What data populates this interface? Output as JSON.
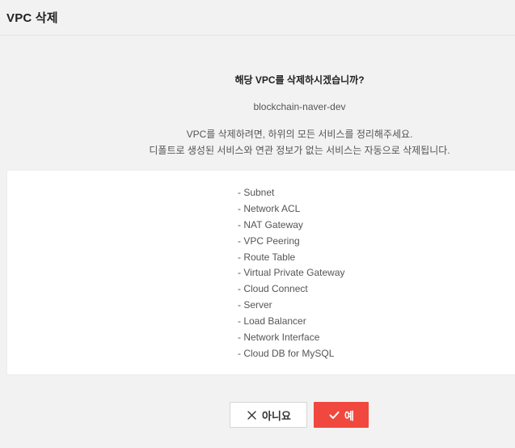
{
  "dialog": {
    "title": "VPC 삭제",
    "question": "해당 VPC를 삭제하시겠습니까?",
    "vpc_name": "blockchain-naver-dev",
    "description_line1": "VPC를 삭제하려면, 하위의 모든 서비스를 정리해주세요.",
    "description_line2": "디폴트로 생성된 서비스와 연관 정보가 없는 서비스는 자동으로 삭제됩니다.",
    "services": [
      "- Subnet",
      "- Network ACL",
      "- NAT Gateway",
      "- VPC Peering",
      "- Route Table",
      "- Virtual Private Gateway",
      "- Cloud Connect",
      "- Server",
      "- Load Balancer",
      "- Network Interface",
      "- Cloud DB for MySQL"
    ]
  },
  "buttons": {
    "cancel_label": "아니요",
    "cancel_icon": "close-icon",
    "ok_label": "예",
    "ok_icon": "check-icon"
  },
  "colors": {
    "accent": "#f0483e",
    "background": "#f2f2f2",
    "panel": "#ffffff"
  }
}
